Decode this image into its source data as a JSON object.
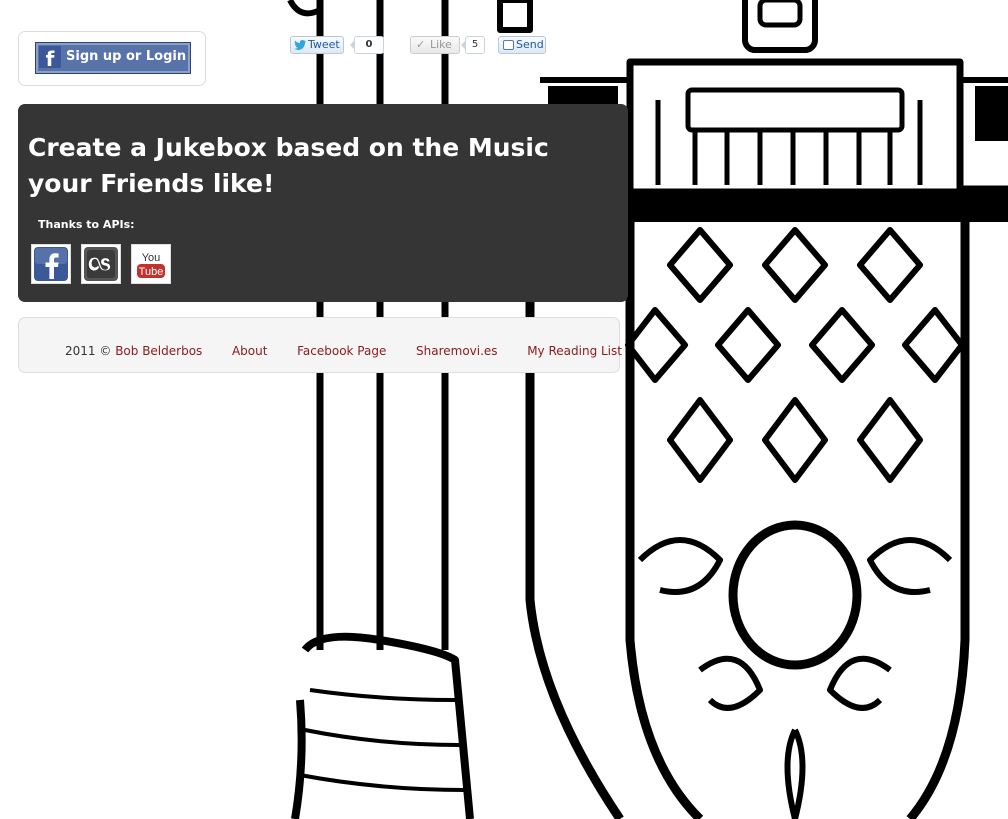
{
  "auth": {
    "login_label": "Sign up or Login",
    "fb_letter": "f"
  },
  "social": {
    "tweet_label": "Tweet",
    "tweet_count": "0",
    "like_label": "Like",
    "like_count": "5",
    "send_label": "Send"
  },
  "hero": {
    "headline": "Create a Jukebox based on the Music your Friends like!",
    "thanks_label": "Thanks to APIs:",
    "apis": [
      {
        "name": "facebook",
        "icon": "facebook-icon",
        "color": "#3b5998"
      },
      {
        "name": "lastfm",
        "icon": "lastfm-icon",
        "color": "#555555"
      },
      {
        "name": "youtube",
        "icon": "youtube-icon",
        "color": "#c4302b",
        "text_you": "You",
        "text_tube": "Tube"
      }
    ]
  },
  "footer": {
    "copyright": "2011 ©",
    "author_link": "Bob Belderbos",
    "links": [
      "About",
      "Facebook Page",
      "Sharemovi.es",
      "My Reading List"
    ]
  },
  "colors": {
    "panel": "#353535",
    "link": "#8b1a1a",
    "facebook": "#3b5998"
  }
}
